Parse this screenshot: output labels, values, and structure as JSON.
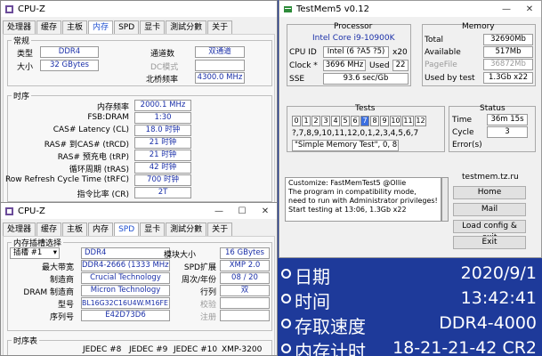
{
  "cpuz1": {
    "title": "CPU-Z",
    "tabs": [
      "处理器",
      "缓存",
      "主板",
      "内存",
      "SPD",
      "显卡",
      "測試分數",
      "关于"
    ],
    "active_tab": 3,
    "general": {
      "title": "常规",
      "type_label": "类型",
      "type": "DDR4",
      "size_label": "大小",
      "size": "32 GBytes",
      "channels_label": "通道数",
      "channels": "双通道",
      "dcmode_label": "DC模式",
      "nb_label": "北桥频率",
      "nb": "4300.0 MHz"
    },
    "timings": {
      "title": "时序",
      "rows": [
        {
          "label": "内存频率",
          "value": "2000.1 MHz"
        },
        {
          "label": "FSB:DRAM",
          "value": "1:30"
        },
        {
          "label": "CAS# Latency (CL)",
          "value": "18.0 时钟"
        },
        {
          "label": "RAS# 到CAS# (tRCD)",
          "value": "21 时钟"
        },
        {
          "label": "RAS# 预充电 (tRP)",
          "value": "21 时钟"
        },
        {
          "label": "循环周期 (tRAS)",
          "value": "42 时钟"
        },
        {
          "label": "Row Refresh Cycle Time (tRFC)",
          "value": "700 时钟"
        },
        {
          "label": "指令比率 (CR)",
          "value": "2T"
        }
      ]
    }
  },
  "cpuz2": {
    "title": "CPU-Z",
    "tabs": [
      "处理器",
      "缓存",
      "主板",
      "内存",
      "SPD",
      "显卡",
      "測試分數",
      "关于"
    ],
    "active_tab": 4,
    "slot": {
      "title": "内存插槽选择",
      "slot_value": "插槽 #1",
      "type": "DDR4",
      "module_size_label": "模块大小",
      "module_size": "16 GBytes",
      "maxbw_label": "最大带宽",
      "maxbw": "DDR4-2666 (1333 MHz)",
      "spd_label": "SPD扩展",
      "spd": "XMP 2.0",
      "mfr_label": "制造商",
      "mfr": "Crucial Technology",
      "week_label": "周次/年份",
      "week": "08 / 20",
      "dram_label": "DRAM 制造商",
      "dram": "Micron Technology",
      "rank_label": "行列",
      "rank": "双",
      "pn_label": "型号",
      "pn": "BL16G32C16U4W.M16FE1",
      "check_label": "校验",
      "sn_label": "序列号",
      "sn": "E42D73D6",
      "reg_label": "注册"
    },
    "timing_table": {
      "title": "时序表",
      "headers": [
        "JEDEC #8",
        "JEDEC #9",
        "JEDEC #10",
        "XMP-3200"
      ]
    }
  },
  "testmem": {
    "title": "TestMem5 v0.12",
    "processor": {
      "title": "Processor",
      "name": "Intel Core i9-10900K",
      "cpuid_label": "CPU ID",
      "cpuid": "Intel (6 ?A5 ?5)",
      "threads": "x20",
      "clock_label": "Clock *",
      "clock": "3696 MHz",
      "used_label": "Used",
      "used": "22",
      "sse_label": "SSE",
      "sse": "93.6 sec/Gb"
    },
    "memory": {
      "title": "Memory",
      "total_label": "Total",
      "total": "32690Mb",
      "avail_label": "Available",
      "avail": "517Mb",
      "pagefile_label": "PageFile",
      "pagefile": "36872Mb",
      "usedby_label": "Used by test",
      "usedby": "1.3Gb x22"
    },
    "tests": {
      "title": "Tests",
      "cells": [
        "0",
        "1",
        "2",
        "3",
        "4",
        "5",
        "6",
        "7",
        "8",
        "9",
        "10",
        "11",
        "12"
      ],
      "active": 7,
      "sequence": "?,7,8,9,10,11,12,0,1,2,3,4,5,6,7",
      "config": "\"Simple Memory Test\", 0, 8Mb"
    },
    "status": {
      "title": "Status",
      "time_label": "Time",
      "time": "36m 15s",
      "cycle_label": "Cycle",
      "cycle": "3",
      "errors_label": "Error(s)",
      "errors": ""
    },
    "log": [
      "Customize: FastMemTest5 @Ollie",
      "The program in compatibility mode,",
      "need to run with Administrator privileges!",
      "Start testing at 13:06, 1.3Gb x22"
    ],
    "site": "testmem.tz.ru",
    "buttons": [
      "Home",
      "Mail",
      "Load config & exit",
      "Exit"
    ]
  },
  "osd": [
    {
      "label": "日期",
      "value": "2020/9/1"
    },
    {
      "label": "时间",
      "value": "13:42:41"
    },
    {
      "label": "存取速度",
      "value": "DDR4-4000"
    },
    {
      "label": "内存计时",
      "value": "18-21-21-42 CR2"
    }
  ],
  "colors": {
    "accent": "#1e4fd0",
    "background": "#1e3a9a",
    "osd_text": "#ffffff"
  }
}
